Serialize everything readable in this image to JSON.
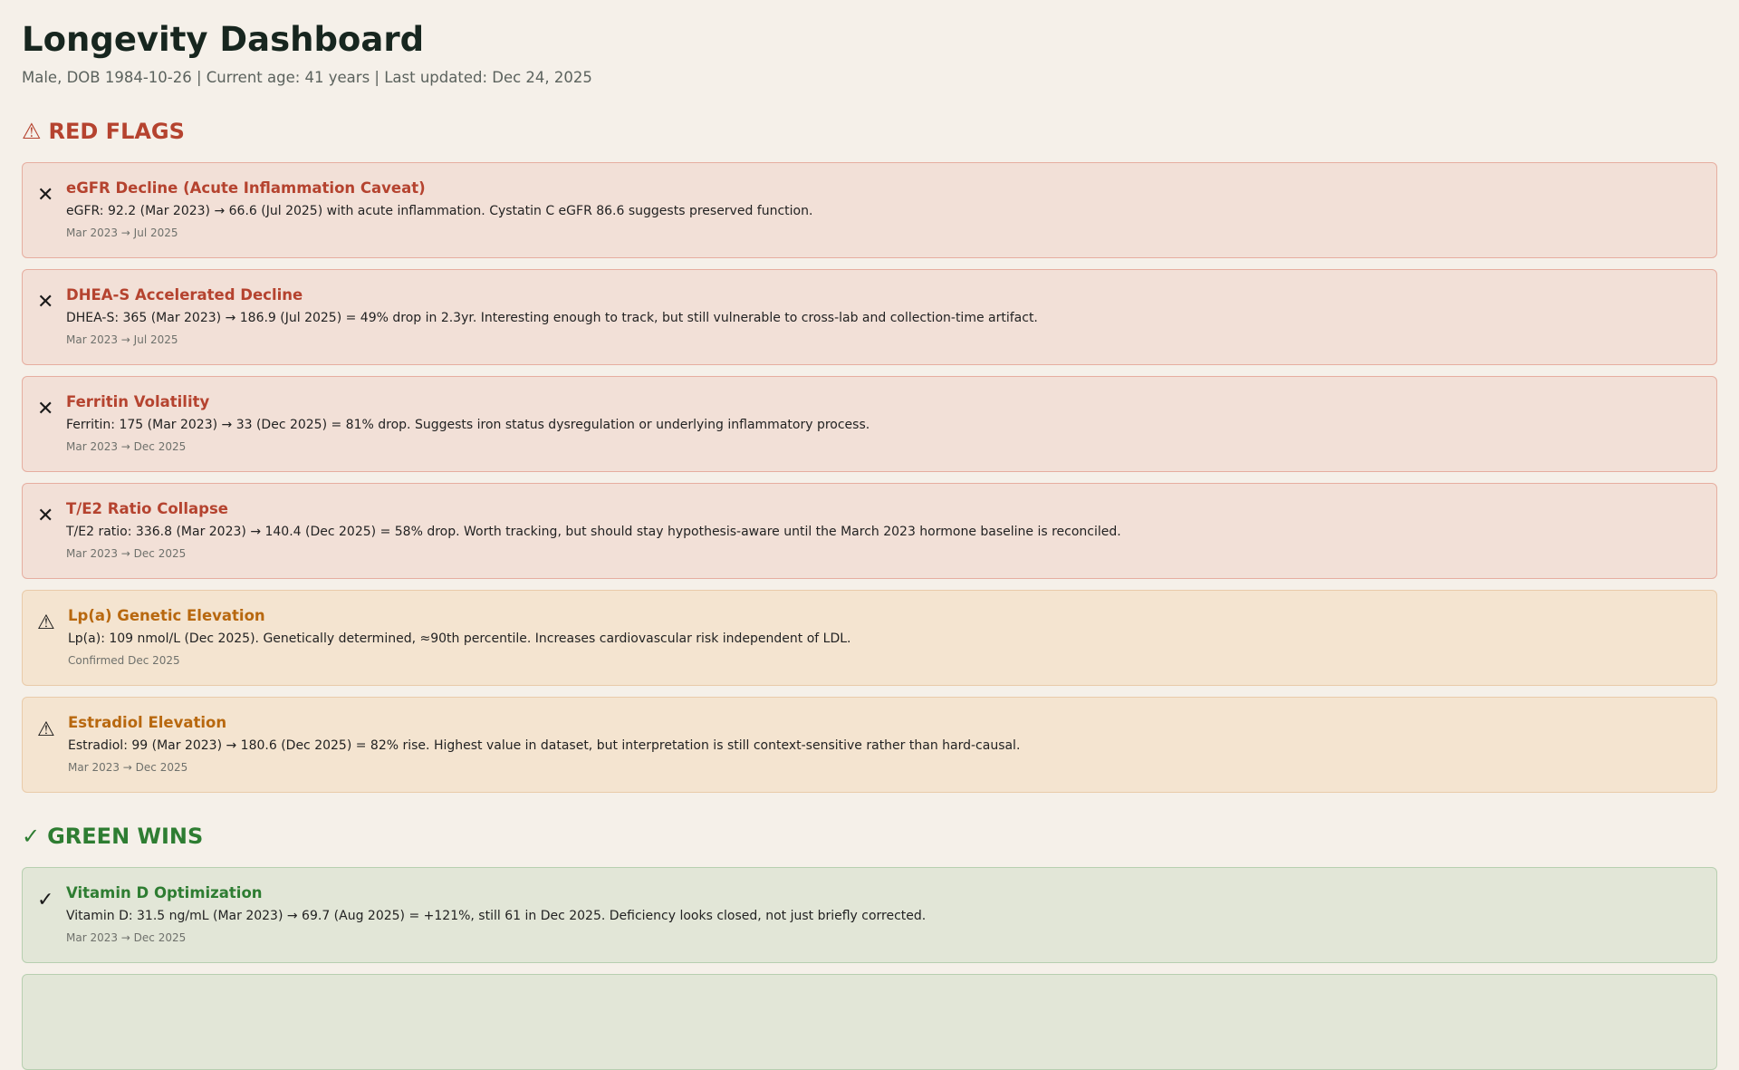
{
  "header": {
    "title": "Longevity Dashboard",
    "subtitle": "Male, DOB 1984-10-26 | Current age: 41 years | Last updated: Dec 24, 2025"
  },
  "red_flags": {
    "icon": "⚠",
    "label": "RED FLAGS",
    "items": [
      {
        "severity": "red",
        "icon": "✕",
        "title": "eGFR Decline (Acute Inflammation Caveat)",
        "desc": "eGFR: 92.2 (Mar 2023) → 66.6 (Jul 2025) with acute inflammation. Cystatin C eGFR 86.6 suggests preserved function.",
        "date": "Mar 2023 → Jul 2025"
      },
      {
        "severity": "red",
        "icon": "✕",
        "title": "DHEA-S Accelerated Decline",
        "desc": "DHEA-S: 365 (Mar 2023) → 186.9 (Jul 2025) = 49% drop in 2.3yr. Interesting enough to track, but still vulnerable to cross-lab and collection-time artifact.",
        "date": "Mar 2023 → Jul 2025"
      },
      {
        "severity": "red",
        "icon": "✕",
        "title": "Ferritin Volatility",
        "desc": "Ferritin: 175 (Mar 2023) → 33 (Dec 2025) = 81% drop. Suggests iron status dysregulation or underlying inflammatory process.",
        "date": "Mar 2023 → Dec 2025"
      },
      {
        "severity": "red",
        "icon": "✕",
        "title": "T/E2 Ratio Collapse",
        "desc": "T/E2 ratio: 336.8 (Mar 2023) → 140.4 (Dec 2025) = 58% drop. Worth tracking, but should stay hypothesis-aware until the March 2023 hormone baseline is reconciled.",
        "date": "Mar 2023 → Dec 2025"
      },
      {
        "severity": "amber",
        "icon": "⚠",
        "title": "Lp(a) Genetic Elevation",
        "desc": "Lp(a): 109 nmol/L (Dec 2025). Genetically determined, ≈90th percentile. Increases cardiovascular risk independent of LDL.",
        "date": "Confirmed Dec 2025"
      },
      {
        "severity": "amber",
        "icon": "⚠",
        "title": "Estradiol Elevation",
        "desc": "Estradiol: 99 (Mar 2023) → 180.6 (Dec 2025) = 82% rise. Highest value in dataset, but interpretation is still context-sensitive rather than hard-causal.",
        "date": "Mar 2023 → Dec 2025"
      }
    ]
  },
  "green_wins": {
    "icon": "✓",
    "label": "GREEN WINS",
    "items": [
      {
        "severity": "green",
        "icon": "✓",
        "title": "Vitamin D Optimization",
        "desc": "Vitamin D: 31.5 ng/mL (Mar 2023) → 69.7 (Aug 2025) = +121%, still 61 in Dec 2025. Deficiency looks closed, not just briefly corrected.",
        "date": "Mar 2023 → Dec 2025"
      },
      {
        "severity": "green",
        "icon": "",
        "title": "",
        "desc": "",
        "date": ""
      }
    ]
  }
}
